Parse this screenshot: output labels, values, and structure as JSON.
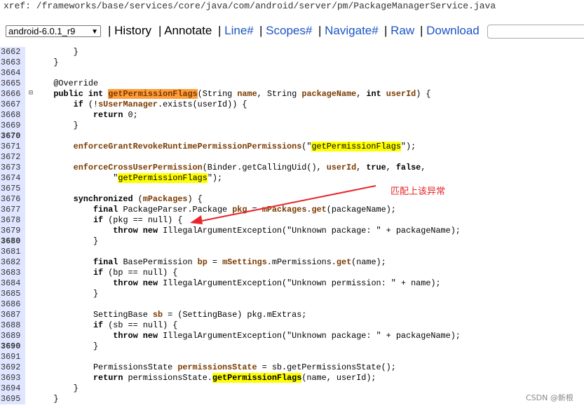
{
  "xref": {
    "path": "xref: /frameworks/base/services/core/java/com/android/server/pm/PackageManagerService.java"
  },
  "toolbar": {
    "version_select": "android-6.0.1_r9",
    "history": "History",
    "annotate": "Annotate",
    "line": "Line#",
    "scopes": "Scopes#",
    "navigate": "Navigate#",
    "raw": "Raw",
    "download": "Download",
    "separator": "|"
  },
  "code": {
    "lines": [
      {
        "n": "3662",
        "bold": false
      },
      {
        "n": "3663",
        "bold": false
      },
      {
        "n": "3664",
        "bold": false
      },
      {
        "n": "3665",
        "bold": false
      },
      {
        "n": "3666",
        "bold": false
      },
      {
        "n": "3667",
        "bold": false
      },
      {
        "n": "3668",
        "bold": false
      },
      {
        "n": "3669",
        "bold": false
      },
      {
        "n": "3670",
        "bold": true
      },
      {
        "n": "3671",
        "bold": false
      },
      {
        "n": "3672",
        "bold": false
      },
      {
        "n": "3673",
        "bold": false
      },
      {
        "n": "3674",
        "bold": false
      },
      {
        "n": "3675",
        "bold": false
      },
      {
        "n": "3676",
        "bold": false
      },
      {
        "n": "3677",
        "bold": false
      },
      {
        "n": "3678",
        "bold": false
      },
      {
        "n": "3679",
        "bold": false
      },
      {
        "n": "3680",
        "bold": true
      },
      {
        "n": "3681",
        "bold": false
      },
      {
        "n": "3682",
        "bold": false
      },
      {
        "n": "3683",
        "bold": false
      },
      {
        "n": "3684",
        "bold": false
      },
      {
        "n": "3685",
        "bold": false
      },
      {
        "n": "3686",
        "bold": false
      },
      {
        "n": "3687",
        "bold": false
      },
      {
        "n": "3688",
        "bold": false
      },
      {
        "n": "3689",
        "bold": false
      },
      {
        "n": "3690",
        "bold": true
      },
      {
        "n": "3691",
        "bold": false
      },
      {
        "n": "3692",
        "bold": false
      },
      {
        "n": "3693",
        "bold": false
      },
      {
        "n": "3694",
        "bold": false
      },
      {
        "n": "3695",
        "bold": false
      }
    ],
    "tokens": {
      "brace_close": "}",
      "override": "@Override",
      "public": "public",
      "int": "int",
      "method_name": "getPermissionFlags",
      "sig_rest_1": "(String ",
      "name": "name",
      "sig_rest_2": ", String ",
      "packageName": "packageName",
      "sig_rest_3": ", ",
      "int2": "int",
      "userId": "userId",
      "sig_rest_4": ") {",
      "if": "if",
      "l3667_a": " (!",
      "sUserManager": "sUserManager",
      "l3667_b": ".exists(userId)) {",
      "return": "return",
      "zero": " 0;",
      "enforceGrant": "enforceGrantRevokeRuntimePermissionPermissions",
      "str_open": "(\"",
      "str_method": "getPermissionFlags",
      "str_close": "\");",
      "enforceCross": "enforceCrossUserPermission",
      "l3673_a": "(Binder.getCallingUid(), ",
      "true": "true",
      "false": "false",
      "comma_sp": ", ",
      "comma": ",",
      "quote_open": "\"",
      "l3674_close": "\");",
      "synchronized": "synchronized",
      "l3676_a": " (",
      "mPackages": "mPackages",
      "l3676_b": ") {",
      "final": "final",
      "l3677_a": " PackageParser.Package ",
      "pkg": "pkg",
      "eq": " = ",
      "l3677_b": ".",
      "get": "get",
      "l3677_c": "(packageName);",
      "l3678": " (pkg == null) {",
      "throw": "throw",
      "new": "new",
      "l3679": " IllegalArgumentException(\"Unknown package: \" + packageName);",
      "l3682_a": " BasePermission ",
      "bp": "bp",
      "mSettings": "mSettings",
      "l3682_b": ".mPermissions.",
      "l3682_c": "(name);",
      "l3683": " (bp == null) {",
      "l3684": " IllegalArgumentException(\"Unknown permission: \" + name);",
      "l3687_a": "SettingBase ",
      "sb": "sb",
      "l3687_b": " = (SettingBase) pkg.mExtras;",
      "l3688": " (sb == null) {",
      "l3689": " IllegalArgumentException(\"Unknown package: \" + packageName);",
      "l3692_a": "PermissionsState ",
      "permissionsState": "permissionsState",
      "l3692_b": " = sb.getPermissionsState();",
      "l3693_a": " permissionsState.",
      "l3693_b": "(name, userId);",
      "fold": "⊟"
    }
  },
  "annotation": {
    "text": "匹配上该异常",
    "color": "#e8262a"
  },
  "watermark": {
    "text": "CSDN @新根"
  }
}
